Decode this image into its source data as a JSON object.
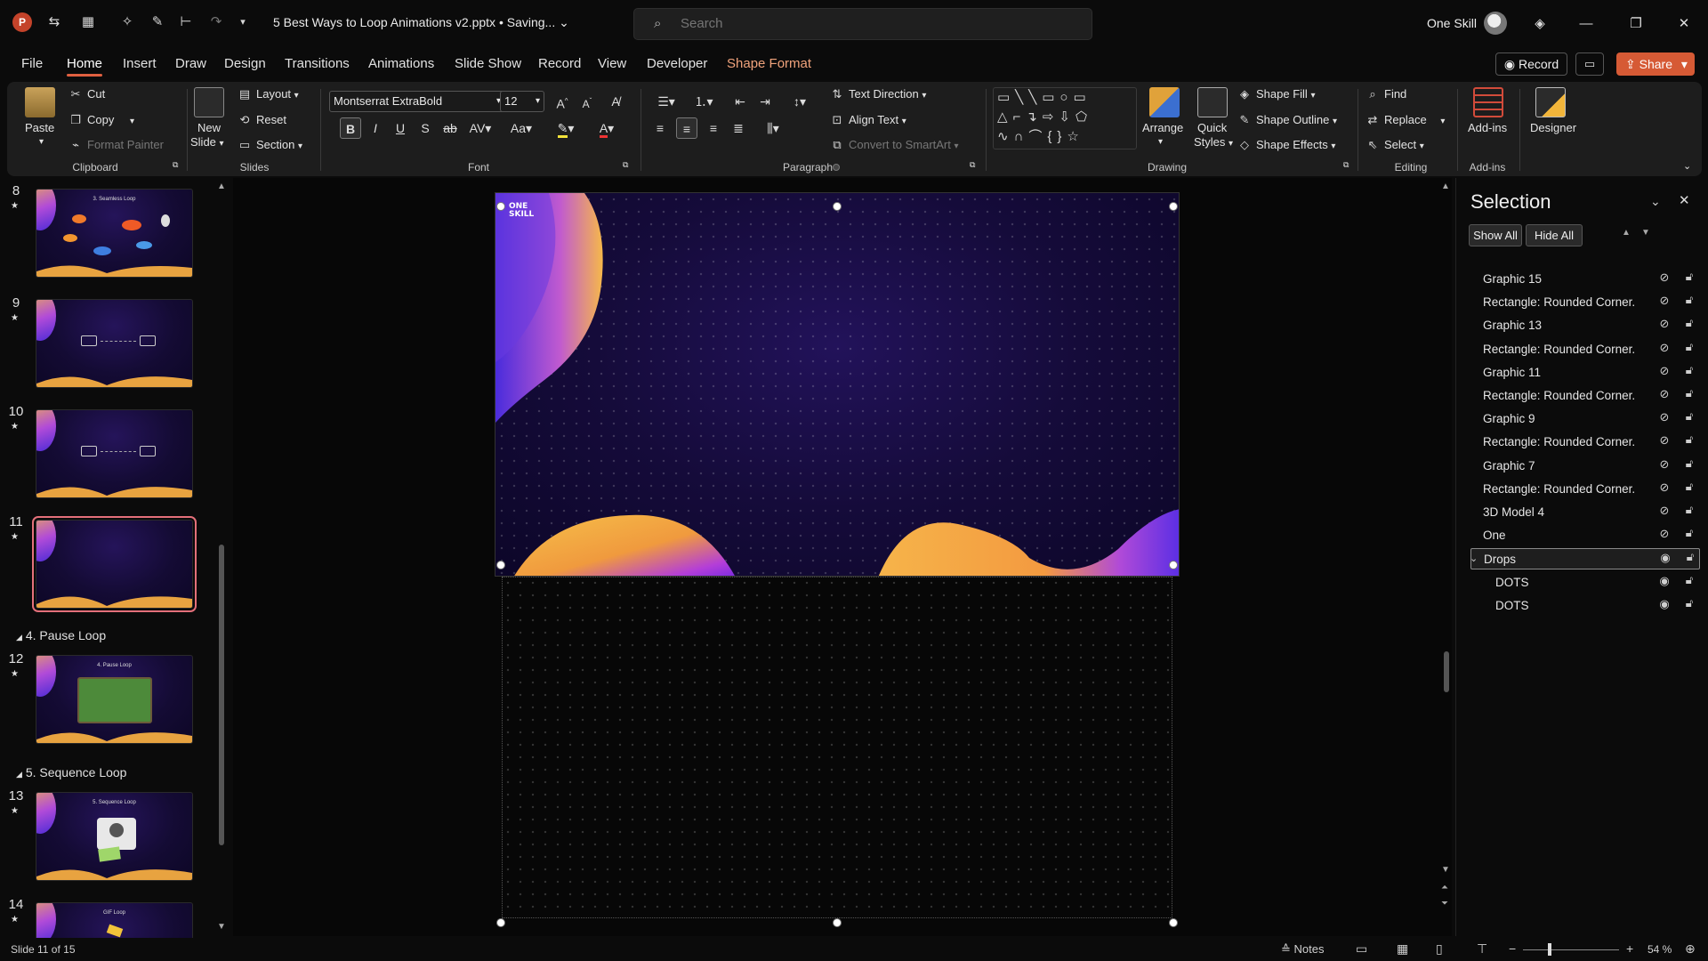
{
  "app": {
    "doc_title": "5 Best Ways to Loop Animations v2.pptx • Saving... ⌄",
    "search_placeholder": "Search",
    "user_name": "One Skill"
  },
  "icons": {
    "app": "powerpoint-icon",
    "search": "search-icon",
    "minimize": "minimize-icon",
    "maximize": "maximize-icon",
    "close": "close-icon"
  },
  "tabs": [
    "File",
    "Home",
    "Insert",
    "Draw",
    "Design",
    "Transitions",
    "Animations",
    "Slide Show",
    "Record",
    "View",
    "Developer",
    "Shape Format"
  ],
  "active_tab": "Home",
  "top_buttons": {
    "record": "Record",
    "share": "Share"
  },
  "ribbon": {
    "clipboard": {
      "paste": "Paste",
      "cut": "Cut",
      "copy": "Copy",
      "format_painter": "Format Painter",
      "label": "Clipboard"
    },
    "slides": {
      "new_slide_1": "New",
      "new_slide_2": "Slide",
      "layout": "Layout",
      "reset": "Reset",
      "section": "Section",
      "label": "Slides"
    },
    "font": {
      "family": "Montserrat ExtraBold",
      "size": "12",
      "label": "Font"
    },
    "paragraph": {
      "text_direction": "Text Direction",
      "align_text": "Align Text",
      "convert_smartart": "Convert to SmartArt",
      "label": "Paragraph"
    },
    "drawing": {
      "arrange": "Arrange",
      "quick_styles_1": "Quick",
      "quick_styles_2": "Styles",
      "shape_fill": "Shape Fill",
      "shape_outline": "Shape Outline",
      "shape_effects": "Shape Effects",
      "label": "Drawing"
    },
    "editing": {
      "find": "Find",
      "replace": "Replace",
      "select": "Select",
      "label": "Editing"
    },
    "addins": {
      "addins": "Add-ins",
      "designer": "Designer",
      "label": "Add-ins"
    }
  },
  "thumbnails": {
    "sections": {
      "pause": "4. Pause Loop",
      "sequence": "5. Sequence Loop"
    },
    "slides": [
      {
        "num": "8",
        "title": "3. Seamless Loop"
      },
      {
        "num": "9",
        "title": ""
      },
      {
        "num": "10",
        "title": ""
      },
      {
        "num": "11",
        "title": ""
      },
      {
        "num": "12",
        "title": "4. Pause Loop"
      },
      {
        "num": "13",
        "title": "5. Sequence Loop"
      },
      {
        "num": "14",
        "title": "GIF Loop"
      }
    ],
    "selected_slide": "11"
  },
  "slide_logo": {
    "line1": "ONE",
    "line2": "SKILL"
  },
  "selection_pane": {
    "title": "Selection",
    "show_all": "Show All",
    "hide_all": "Hide All",
    "items": [
      {
        "label": "Graphic 15",
        "visible": false,
        "child": false
      },
      {
        "label": "Rectangle: Rounded Corner...",
        "visible": false,
        "child": false
      },
      {
        "label": "Graphic 13",
        "visible": false,
        "child": false
      },
      {
        "label": "Rectangle: Rounded Corner...",
        "visible": false,
        "child": false
      },
      {
        "label": "Graphic 11",
        "visible": false,
        "child": false
      },
      {
        "label": "Rectangle: Rounded Corner...",
        "visible": false,
        "child": false
      },
      {
        "label": "Graphic 9",
        "visible": false,
        "child": false
      },
      {
        "label": "Rectangle: Rounded Corner...",
        "visible": false,
        "child": false
      },
      {
        "label": "Graphic 7",
        "visible": false,
        "child": false
      },
      {
        "label": "Rectangle: Rounded Corner...",
        "visible": false,
        "child": false
      },
      {
        "label": "3D Model 4",
        "visible": false,
        "child": false
      },
      {
        "label": "One",
        "visible": false,
        "child": false
      },
      {
        "label": "Drops",
        "visible": true,
        "child": false,
        "group": true,
        "selected": true
      },
      {
        "label": "DOTS",
        "visible": true,
        "child": true
      },
      {
        "label": "DOTS",
        "visible": true,
        "child": true
      }
    ]
  },
  "status": {
    "slide_info": "Slide 11 of 15",
    "notes": "Notes",
    "zoom": "54 %"
  }
}
